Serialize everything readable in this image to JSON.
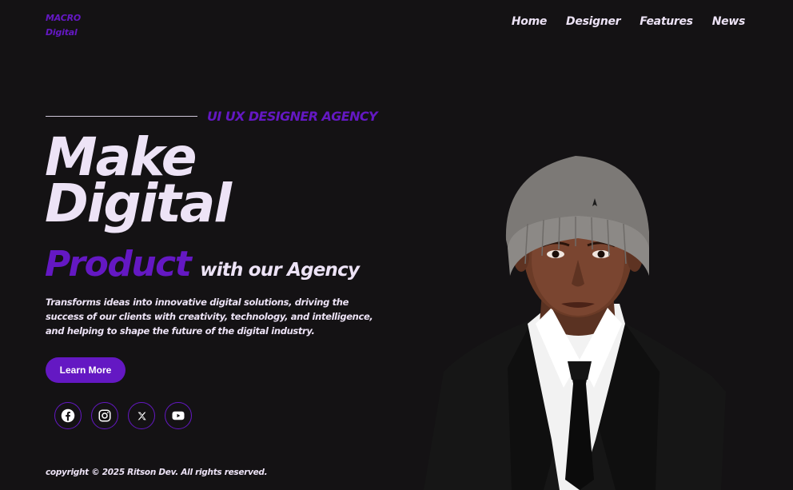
{
  "brand": {
    "line1": "MACRO",
    "line2": "Digital",
    "accent_color": "#6418c3",
    "text_color": "#ede3f6",
    "background_color": "#141214"
  },
  "nav": {
    "items": [
      {
        "label": "Home"
      },
      {
        "label": "Designer"
      },
      {
        "label": "Features"
      },
      {
        "label": "News"
      }
    ]
  },
  "hero": {
    "tagline": "UI UX DESIGNER AGENCY",
    "headline_line1": "Make",
    "headline_line2": "Digital",
    "product_word": "Product",
    "agency_phrase": "with our Agency",
    "description": "Transforms ideas into innovative digital solutions, driving the success of our clients with creativity, technology, and intelligence, and helping to shape the future of the digital industry.",
    "cta_label": "Learn More"
  },
  "socials": [
    {
      "icon": "facebook-icon"
    },
    {
      "icon": "instagram-icon"
    },
    {
      "icon": "x-twitter-icon"
    },
    {
      "icon": "youtube-icon"
    }
  ],
  "footer": {
    "copyright": "copyright © 2025 Ritson Dev. All rights reserved."
  }
}
